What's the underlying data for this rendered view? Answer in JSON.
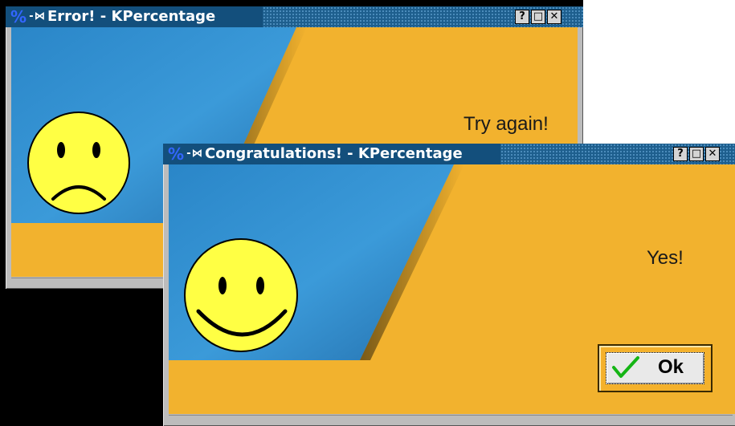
{
  "error_window": {
    "app_icon": "%",
    "pin_icon": "-⋈",
    "title": "Error! - KPercentage",
    "buttons": {
      "help": "?",
      "maximize": "□",
      "close": "✕"
    },
    "message": "Try again!",
    "face": "sad-face-icon"
  },
  "congrats_window": {
    "app_icon": "%",
    "pin_icon": "-⋈",
    "title": "Congratulations! - KPercentage",
    "buttons": {
      "help": "?",
      "maximize": "□",
      "close": "✕"
    },
    "message": "Yes!",
    "face": "happy-face-icon",
    "ok_label": "Ok"
  },
  "colors": {
    "orange": "#f2b22e",
    "blue": "#2d8ccf",
    "titlebar": "#1e5f8e",
    "face_yellow": "#ffff44"
  }
}
